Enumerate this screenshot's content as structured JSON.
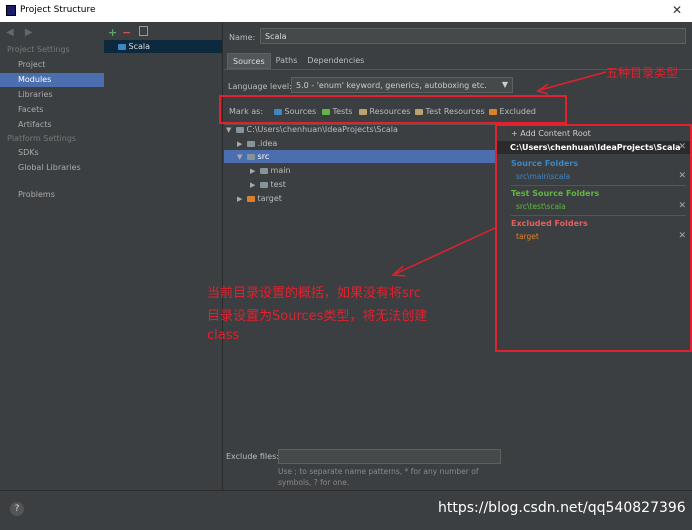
{
  "window": {
    "title": "Project Structure",
    "close": "✕"
  },
  "nav": {
    "back_forward": "◀ ▶",
    "project_settings_header": "Project Settings",
    "project_settings": [
      "Project",
      "Modules",
      "Libraries",
      "Facets",
      "Artifacts"
    ],
    "platform_settings_header": "Platform Settings",
    "platform_settings": [
      "SDKs",
      "Global Libraries"
    ],
    "problems": "Problems",
    "selected": "Modules"
  },
  "modules": {
    "add": "+",
    "remove": "−",
    "list": [
      "Scala"
    ]
  },
  "module": {
    "name_label": "Name:",
    "name_value": "Scala",
    "tabs": [
      "Sources",
      "Paths",
      "Dependencies"
    ],
    "active_tab": "Sources",
    "language_level_label": "Language level:",
    "language_level_value": "5.0 - 'enum' keyword, generics, autoboxing etc.",
    "mark_as_label": "Mark as:",
    "mark_as": [
      "Sources",
      "Tests",
      "Resources",
      "Test Resources",
      "Excluded"
    ]
  },
  "tree": [
    {
      "label": "C:\\Users\\chenhuan\\IdeaProjects\\Scala",
      "expanded": true
    },
    {
      "label": ".idea",
      "expanded": false
    },
    {
      "label": "src",
      "expanded": true
    },
    {
      "label": "main",
      "expanded": false
    },
    {
      "label": "test",
      "expanded": false
    },
    {
      "label": "target",
      "expanded": false
    }
  ],
  "content_root": {
    "add_label": "+ Add Content Root",
    "path": "C:\\Users\\chenhuan\\IdeaProjects\\Scala",
    "source_header": "Source Folders",
    "source_items": [
      "src\\main\\scala"
    ],
    "test_header": "Test Source Folders",
    "test_items": [
      "src\\test\\scala"
    ],
    "excluded_header": "Excluded Folders",
    "excluded_items": [
      "target"
    ]
  },
  "annotations": {
    "top": "五种目录类型",
    "middle_lines": [
      "当前目录设置的概括，如果没有将src",
      "目录设置为Sources类型，将无法创建",
      "class"
    ]
  },
  "exclude": {
    "label": "Exclude files:",
    "hint": "Use ; to separate name patterns, * for any number of symbols, ? for one."
  },
  "help": "?",
  "watermark": "https://blog.csdn.net/qq540827396",
  "colors": {
    "selection": "#4b6eaf",
    "annotation": "#e0212e",
    "source": "#3e86c4",
    "test": "#62b543",
    "excluded": "#d9822b"
  }
}
